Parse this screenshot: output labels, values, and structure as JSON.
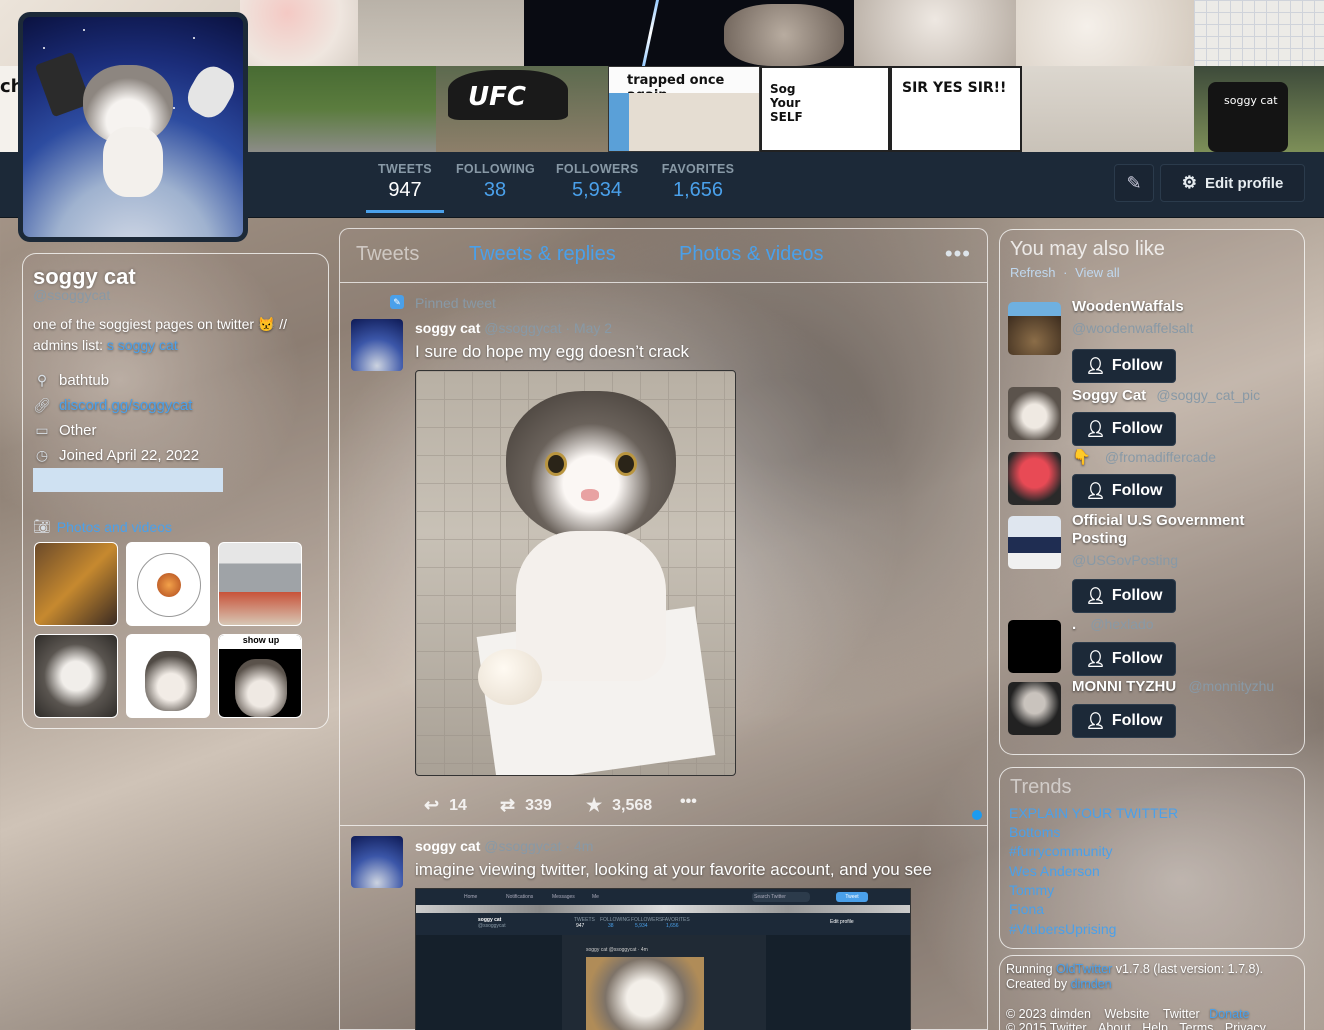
{
  "banner": {
    "captions": [
      "trapped once again",
      "Sog Your SELF",
      "SIR YES SIR!!",
      "soggy cat",
      "UFC",
      "ch"
    ]
  },
  "profile": {
    "name": "soggy cat",
    "handle": "@ssoggycat",
    "bio_text": "one of the soggiest pages on twitter 😾 //",
    "bio_admins_prefix": "admins list:",
    "bio_admins_link": "s soggy cat",
    "location": "bathtub",
    "website": "discord.gg/soggycat",
    "category": "Other",
    "joined": "Joined April 22, 2022",
    "photos_header": "Photos and videos",
    "photos_thumb_caption": "show up"
  },
  "stats": [
    {
      "label": "TWEETS",
      "value": "947"
    },
    {
      "label": "FOLLOWING",
      "value": "38"
    },
    {
      "label": "FOLLOWERS",
      "value": "5,934"
    },
    {
      "label": "FAVORITES",
      "value": "1,656"
    }
  ],
  "toolbar": {
    "edit_profile_label": "Edit profile"
  },
  "tabs": {
    "tweets": "Tweets",
    "replies": "Tweets & replies",
    "media": "Photos & videos",
    "more": "•••"
  },
  "tweets": [
    {
      "pinned_label": "Pinned tweet",
      "author": "soggy cat",
      "handle": "@ssoggycat",
      "time": "May 2",
      "text": "I sure do hope my egg doesn’t crack",
      "replies": "14",
      "retweets": "339",
      "likes": "3,568",
      "more": "•••"
    },
    {
      "author": "soggy cat",
      "handle": "@ssoggycat",
      "time": "4m",
      "text": "imagine viewing twitter, looking at your favorite account, and you see",
      "embedded_nav": [
        "Home",
        "Notifications",
        "Messages",
        "Me"
      ],
      "embedded_search_placeholder": "Search Twitter",
      "embedded_tweet_button": "Tweet",
      "embedded_name": "soggy cat",
      "embedded_handle": "@ssoggycat",
      "embedded_stats": [
        {
          "label": "TWEETS",
          "value": "947"
        },
        {
          "label": "FOLLOWING",
          "value": "38"
        },
        {
          "label": "FOLLOWERS",
          "value": "5,934"
        },
        {
          "label": "FAVORITES",
          "value": "1,656"
        }
      ],
      "embedded_edit": "Edit profile",
      "embedded_tweet_meta": "soggy cat @ssoggycat · 4m"
    }
  ],
  "who_to_follow": {
    "title": "You may also like",
    "refresh": "Refresh",
    "separator": "·",
    "view_all": "View all",
    "follow_label": "Follow",
    "suggestions": [
      {
        "name": "WoodenWaffals",
        "handle": "@woodenwaffelsalt"
      },
      {
        "name": "Soggy Cat",
        "handle": "@soggy_cat_pic"
      },
      {
        "name": "👇",
        "handle": "@fromadiffercade"
      },
      {
        "name": "Official U.S Government Posting",
        "handle": "@USGovPosting"
      },
      {
        "name": ".",
        "handle": "@hexlado"
      },
      {
        "name": "MONNI TYZHU",
        "handle": "@monnityzhu"
      }
    ]
  },
  "trends": {
    "title": "Trends",
    "items": [
      "EXPLAIN YOUR TWITTER",
      "Bottoms",
      "#furrycommunity",
      "Wes Anderson",
      "Tommy",
      "Fiona",
      "#VtubersUprising"
    ]
  },
  "footer": {
    "running_prefix": "Running ",
    "app_name": "OldTwitter",
    "running_version": " v1.7.8 (last version: 1.7.8).",
    "created_prefix": "Created by ",
    "creator": "dimden",
    "copyright": "© 2023 dimden",
    "links": [
      "Website",
      "Twitter",
      "Donate"
    ],
    "links2": [
      "© 2015 Twitter",
      "About",
      "Help",
      "Terms",
      "Privacy"
    ]
  },
  "colors": {
    "accent": "#4aa0ea",
    "navbar": "#1c2938",
    "muted": "#8899a6"
  }
}
